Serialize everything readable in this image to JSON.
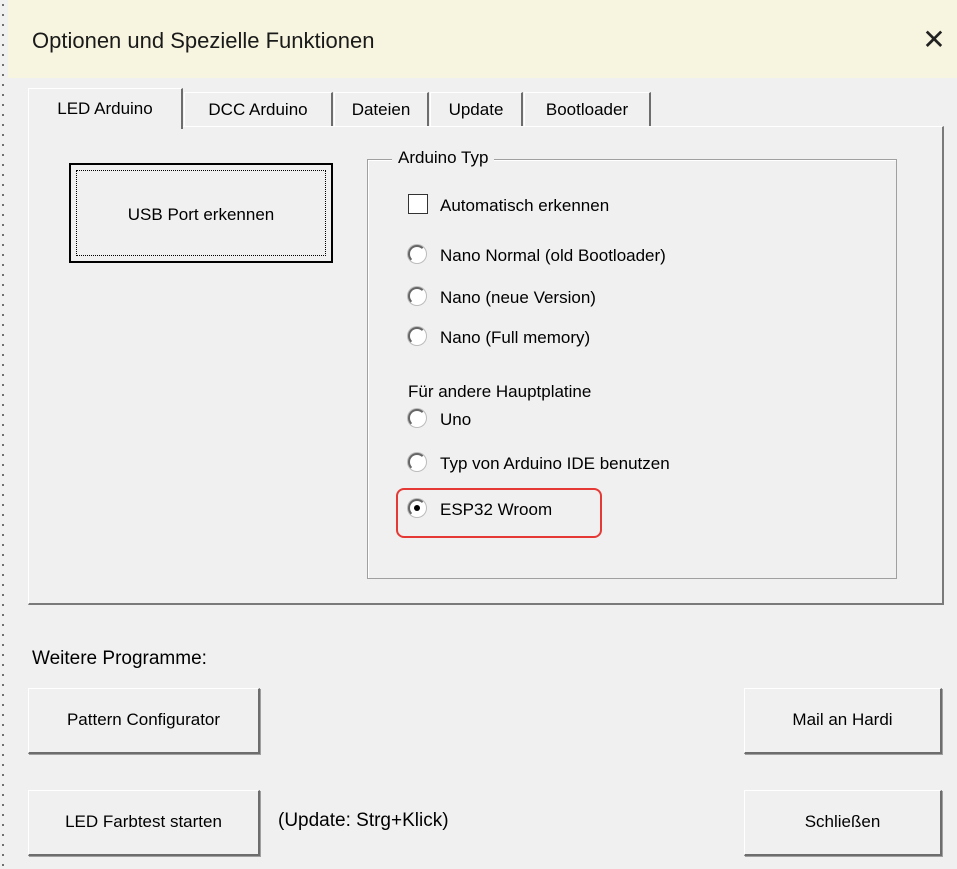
{
  "window": {
    "title": "Optionen und Spezielle Funktionen",
    "close_glyph": "✕"
  },
  "tabs": [
    {
      "label": "LED Arduino",
      "active": true
    },
    {
      "label": "DCC Arduino",
      "active": false
    },
    {
      "label": "Dateien",
      "active": false
    },
    {
      "label": "Update",
      "active": false
    },
    {
      "label": "Bootloader",
      "active": false
    }
  ],
  "usb_button": {
    "label": "USB Port erkennen"
  },
  "arduino_group": {
    "title": "Arduino Typ",
    "auto_detect": {
      "label": "Automatisch erkennen",
      "checked": false
    },
    "options": [
      {
        "label": "Nano Normal (old Bootloader)",
        "selected": false
      },
      {
        "label": "Nano (neue Version)",
        "selected": false
      },
      {
        "label": "Nano (Full memory)",
        "selected": false
      }
    ],
    "other_label": "Für andere Hauptplatine",
    "other_options": [
      {
        "label": "Uno",
        "selected": false
      },
      {
        "label": "Typ von Arduino IDE benutzen",
        "selected": false
      },
      {
        "label": "ESP32 Wroom",
        "selected": true
      }
    ],
    "highlight_color": "#e53935"
  },
  "more_programs": {
    "label": "Weitere Programme:",
    "pattern_button": "Pattern Configurator",
    "mail_button": "Mail an Hardi",
    "farbtest_button": "LED Farbtest starten",
    "update_hint": "(Update: Strg+Klick)",
    "close_button": "Schließen"
  },
  "colors": {
    "background": "#f0f0f0",
    "titlebar": "#f7f5e0"
  }
}
